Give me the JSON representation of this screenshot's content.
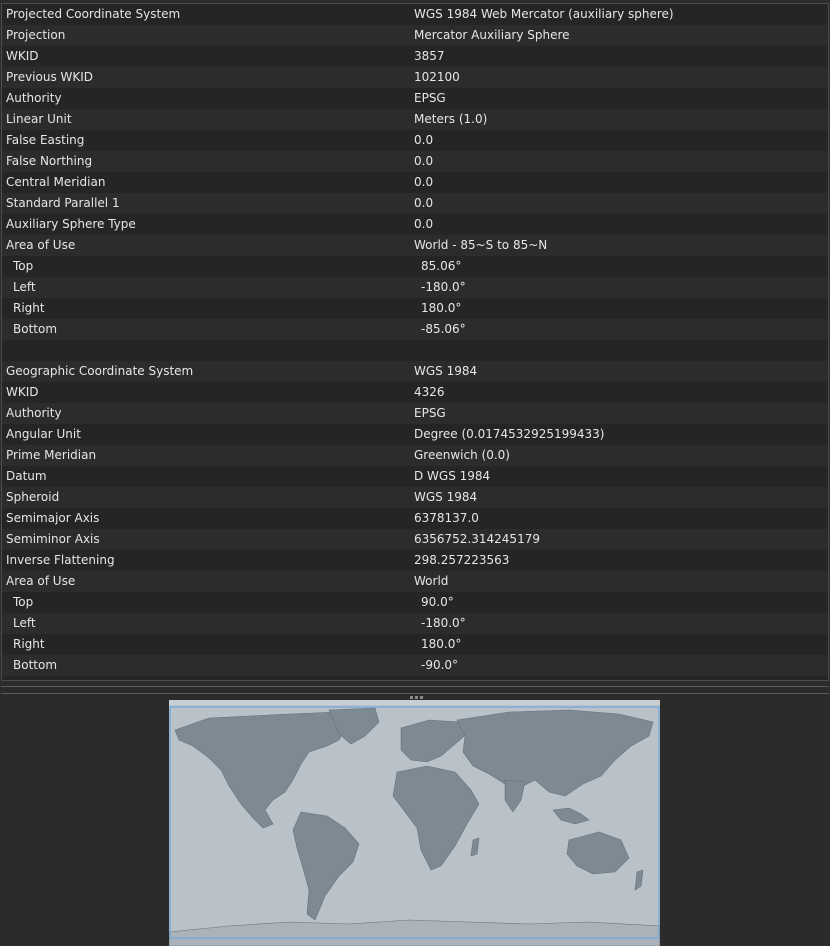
{
  "projected": [
    {
      "key": "Projected Coordinate System",
      "value": "WGS 1984 Web Mercator (auxiliary sphere)"
    },
    {
      "key": "Projection",
      "value": "Mercator Auxiliary Sphere"
    },
    {
      "key": "WKID",
      "value": "3857"
    },
    {
      "key": "Previous WKID",
      "value": "102100"
    },
    {
      "key": "Authority",
      "value": "EPSG"
    },
    {
      "key": "Linear Unit",
      "value": "Meters (1.0)"
    },
    {
      "key": "False Easting",
      "value": "0.0"
    },
    {
      "key": "False Northing",
      "value": "0.0"
    },
    {
      "key": "Central Meridian",
      "value": "0.0"
    },
    {
      "key": "Standard Parallel 1",
      "value": "0.0"
    },
    {
      "key": "Auxiliary Sphere Type",
      "value": "0.0"
    },
    {
      "key": "Area of Use",
      "value": "World - 85~S to 85~N"
    },
    {
      "key": "Top",
      "value": "85.06°",
      "sub": true
    },
    {
      "key": "Left",
      "value": "-180.0°",
      "sub": true
    },
    {
      "key": "Right",
      "value": "180.0°",
      "sub": true
    },
    {
      "key": "Bottom",
      "value": "-85.06°",
      "sub": true
    }
  ],
  "geographic": [
    {
      "key": "Geographic Coordinate System",
      "value": "WGS 1984"
    },
    {
      "key": "WKID",
      "value": "4326"
    },
    {
      "key": "Authority",
      "value": "EPSG"
    },
    {
      "key": "Angular Unit",
      "value": "Degree (0.0174532925199433)"
    },
    {
      "key": "Prime Meridian",
      "value": "Greenwich (0.0)"
    },
    {
      "key": "Datum",
      "value": "D WGS 1984"
    },
    {
      "key": "Spheroid",
      "value": "WGS 1984"
    },
    {
      "key": "Semimajor Axis",
      "value": "6378137.0"
    },
    {
      "key": "Semiminor Axis",
      "value": "6356752.314245179"
    },
    {
      "key": "Inverse Flattening",
      "value": "298.257223563"
    },
    {
      "key": "Area of Use",
      "value": "World"
    },
    {
      "key": "Top",
      "value": "90.0°",
      "sub": true
    },
    {
      "key": "Left",
      "value": "-180.0°",
      "sub": true
    },
    {
      "key": "Right",
      "value": "180.0°",
      "sub": true
    },
    {
      "key": "Bottom",
      "value": "-90.0°",
      "sub": true
    }
  ],
  "colors": {
    "panel_bg": "#252525",
    "row_alt": "#2c2c2c",
    "ocean": "#b9c2c8",
    "land": "#7d8a94",
    "extent_outline": "#6fa6dd"
  },
  "map": {
    "icon": "world-relief-map",
    "extent_icon": "extent-outline"
  }
}
